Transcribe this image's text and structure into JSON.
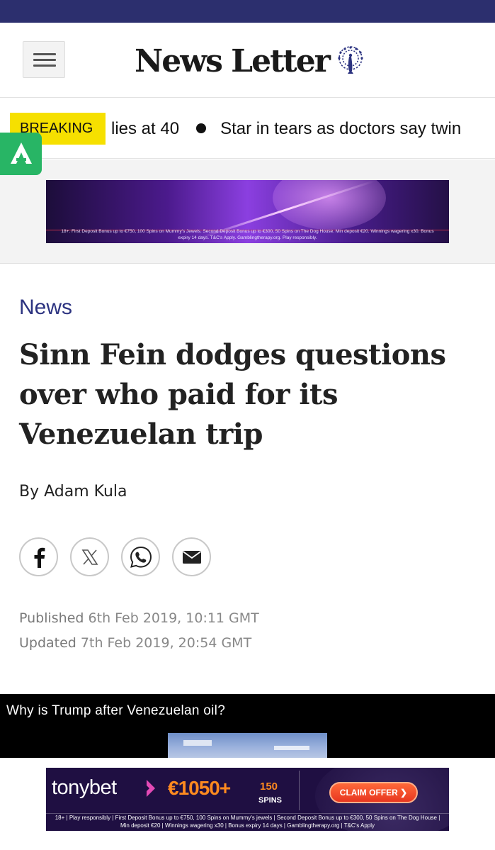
{
  "header": {
    "logo_text": "News Letter",
    "colors": {
      "top_bar": "#2c2f6e",
      "section": "#2c3380",
      "breaking": "#f6e000"
    }
  },
  "ticker": {
    "badge": "BREAKING",
    "items": [
      "lies at 40",
      "Star in tears as doctors say twin"
    ]
  },
  "top_ad": {
    "disclaimer": "18+. First Deposit Bonus up to €750, 100 Spins on Mummy's Jewels. Second Deposit Bonus up to €300, 50 Spins on The Dog House. Min deposit €20. Winnings wagering x30. Bonus expiry 14 days. T&C's Apply. Gamblingtherapy.org. Play responsibly."
  },
  "article": {
    "section": "News",
    "headline": "Sinn Fein dodges questions over who paid for its Venezuelan trip",
    "byline": "By Adam Kula",
    "published_label": "Published",
    "published_value": "6th Feb 2019, 10:11 GMT",
    "updated_label": "Updated",
    "updated_value": "7th Feb 2019, 20:54 GMT",
    "share_icons": [
      "facebook-icon",
      "x-icon",
      "whatsapp-icon",
      "email-icon"
    ]
  },
  "video": {
    "title": "Why is Trump after Venezuelan oil?"
  },
  "bottom_ad": {
    "brand": "tonybet",
    "amount": "€1050+",
    "spins_num": "150",
    "spins_label": "SPINS",
    "cta": "CLAIM OFFER",
    "disclaimer": "18+ | Play responsibly | First Deposit Bonus up to €750, 100 Spins on Mummy's jewels | Second Deposit Bonus up to €300, 50 Spins on The Dog House | Min deposit €20 | Winnings wagering x30 | Bonus expiry 14 days | Gamblingtherapy.org | T&C's Apply"
  }
}
